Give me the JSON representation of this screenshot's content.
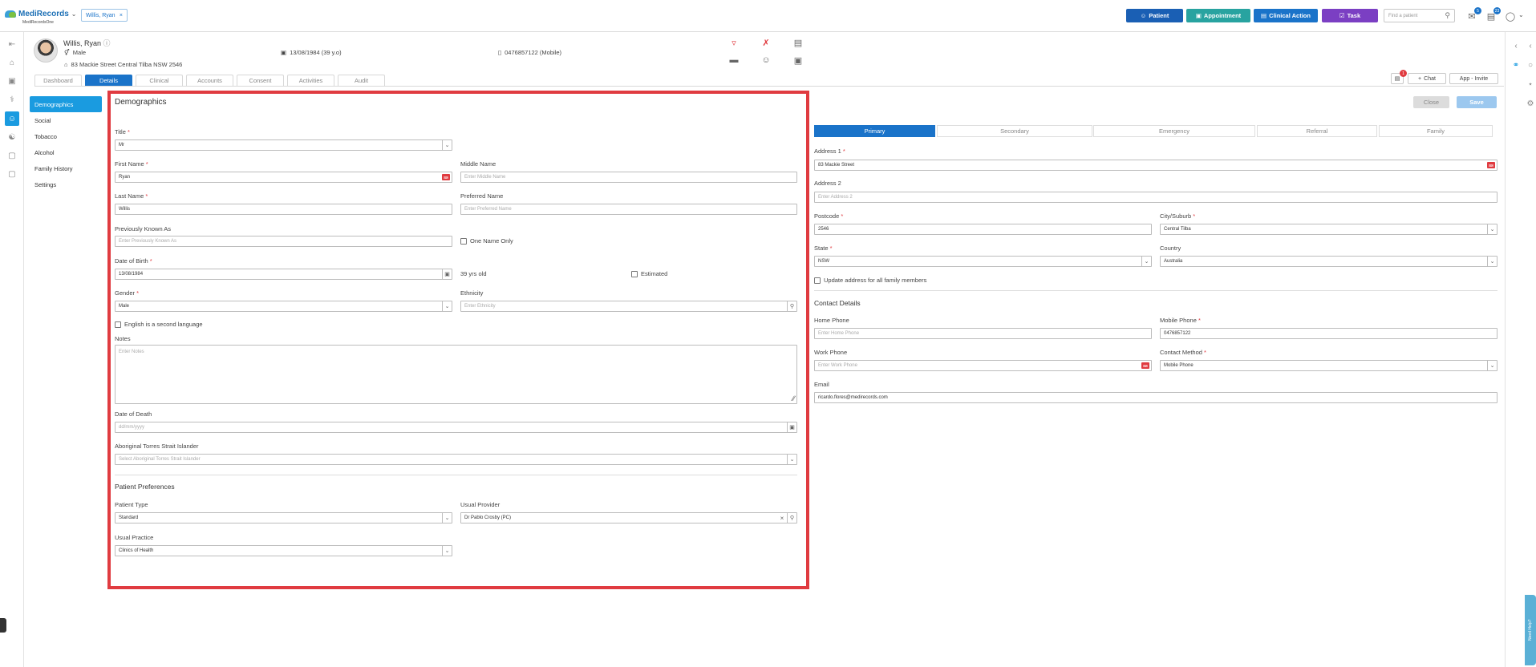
{
  "app": {
    "logo_text": "MediRecords",
    "logo_sub": "MediRecordsOne",
    "open_patient_tab": "Willis, Ryan"
  },
  "toolbar": {
    "patient": "Patient",
    "appointment": "Appointment",
    "clinical_action": "Clinical Action",
    "task": "Task",
    "search_placeholder": "Find a patient",
    "mail_count": "5",
    "inbox_count": "23",
    "colors": {
      "patient": "#1a5fb4",
      "appointment": "#28a3a0",
      "clinical_action": "#1a73c9",
      "task": "#7b3fc3"
    }
  },
  "patient": {
    "name": "Willis, Ryan",
    "gender": "Male",
    "address": "83 Mackie Street Central Tilba NSW 2546",
    "dob": "13/08/1984 (39 y.o)",
    "phone": "0476857122 (Mobile)"
  },
  "tabs": [
    "Dashboard",
    "Details",
    "Clinical",
    "Accounts",
    "Consent",
    "Activities",
    "Audit"
  ],
  "header_actions": {
    "notif_count": "1",
    "chat": "Chat",
    "app_invite": "App - Invite"
  },
  "subnav": [
    "Demographics",
    "Social",
    "Tobacco",
    "Alcohol",
    "Family History",
    "Settings"
  ],
  "demographics": {
    "title": "Demographics",
    "title_label": "Title",
    "title_value": "Mr",
    "first_name_label": "First Name",
    "first_name_value": "Ryan",
    "middle_name_label": "Middle Name",
    "middle_name_placeholder": "Enter Middle Name",
    "last_name_label": "Last Name",
    "last_name_value": "Willis",
    "preferred_name_label": "Preferred Name",
    "preferred_name_placeholder": "Enter Preferred Name",
    "previously_known_label": "Previously Known As",
    "previously_known_placeholder": "Enter Previously Known As",
    "one_name_only": "One Name Only",
    "dob_label": "Date of Birth",
    "dob_value": "13/08/1984",
    "age_text": "39 yrs old",
    "estimated": "Estimated",
    "gender_label": "Gender",
    "gender_value": "Male",
    "ethnicity_label": "Ethnicity",
    "ethnicity_placeholder": "Enter Ethnicity",
    "second_language": "English is a second language",
    "notes_label": "Notes",
    "notes_placeholder": "Enter Notes",
    "dod_label": "Date of Death",
    "dod_placeholder": "dd/mm/yyyy",
    "atsi_label": "Aboriginal Torres Strait Islander",
    "atsi_placeholder": "Select Aboriginal Torres Strait Islander",
    "prefs_title": "Patient Preferences",
    "patient_type_label": "Patient Type",
    "patient_type_value": "Standard",
    "usual_provider_label": "Usual Provider",
    "usual_provider_value": "Dr Pablo Crosby (PC)",
    "usual_practice_label": "Usual Practice",
    "usual_practice_value": "Clinics of Health"
  },
  "right": {
    "close": "Close",
    "save": "Save",
    "tabs": [
      "Primary",
      "Secondary",
      "Emergency",
      "Referral",
      "Family"
    ],
    "address1_label": "Address 1",
    "address1_value": "83 Mackie Street",
    "address2_label": "Address 2",
    "address2_placeholder": "Enter Address 2",
    "postcode_label": "Postcode",
    "postcode_value": "2546",
    "city_label": "City/Suburb",
    "city_value": "Central Tilba",
    "state_label": "State",
    "state_value": "NSW",
    "country_label": "Country",
    "country_value": "Australia",
    "update_family": "Update address for all family members",
    "contact_title": "Contact Details",
    "home_phone_label": "Home Phone",
    "home_phone_placeholder": "Enter Home Phone",
    "mobile_phone_label": "Mobile Phone",
    "mobile_phone_value": "0476857122",
    "work_phone_label": "Work Phone",
    "work_phone_placeholder": "Enter Work Phone",
    "contact_method_label": "Contact Method",
    "contact_method_value": "Mobile Phone",
    "email_label": "Email",
    "email_value": "ricardo.flores@medirecords.com"
  },
  "help": "Need Help?"
}
